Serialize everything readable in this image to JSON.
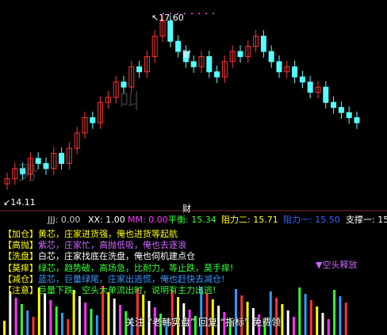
{
  "candles": {
    "high_label": "17.60",
    "low_label": "14.11",
    "marker_label": "财"
  },
  "watermarks": [
    "势",
    "叫",
    "涨"
  ],
  "indicator_bar": {
    "marker": "财",
    "jjj": "JJJ: 0.00",
    "xx": "XX: 1.00",
    "mm": "MM: 0.00",
    "pingheng": "平衡: 15.34",
    "zuli2": "阻力二: 15.71",
    "zuli1": "阻力一: 15.50",
    "zhicheng1": "支撑一: 15"
  },
  "legend": [
    {
      "tag": "【加仓】",
      "text": "黄芯，庄家进货强，俺也进货等起航",
      "color": "#ffff00"
    },
    {
      "tag": "【高抛】",
      "text": "紫芯，庄家忙，高抛低吸，俺也去逐浪",
      "color": "#cc66ff"
    },
    {
      "tag": "【洗盘】",
      "text": "白芯，庄家找底在洗盘，俺也伺机建点仓",
      "color": "#ffffff"
    },
    {
      "tag": "【莫痒】",
      "text": "绿芯，趋势破，高场急，比耐力，等止跌，莫手痒!",
      "color": "#33ff33"
    },
    {
      "tag": "【减仓】",
      "text": "蓝芯，巨量绿尾，庄家出逃慌，俺也赶快去减仓!",
      "color": "#3399ff"
    },
    {
      "tag": "【注意】",
      "text": "巨量下跌，空头大单流出时，说明有主力出逃!",
      "color": "#33ff33"
    }
  ],
  "signal_label": "▼空头释放",
  "footer": "关注 “老韩实盘” 回复 “指标” 免费领",
  "colors": {
    "up": "#ff3333",
    "down": "#54ffff",
    "background": "#000000"
  }
}
